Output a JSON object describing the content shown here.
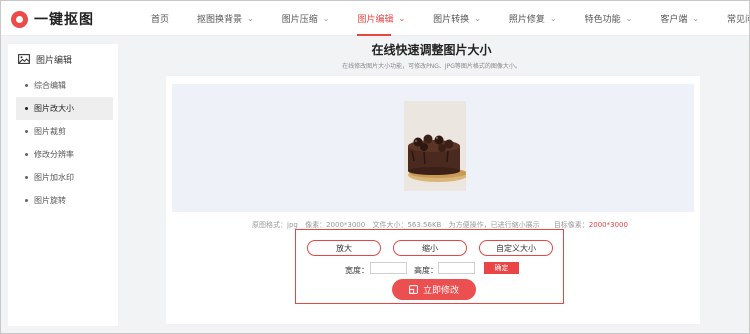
{
  "app": {
    "logo_text": "一键抠图"
  },
  "nav": {
    "items": [
      {
        "label": "首页",
        "has_menu": false
      },
      {
        "label": "抠图换背景",
        "has_menu": true
      },
      {
        "label": "图片压缩",
        "has_menu": true
      },
      {
        "label": "图片编辑",
        "has_menu": true,
        "active": true
      },
      {
        "label": "图片转换",
        "has_menu": true
      },
      {
        "label": "照片修复",
        "has_menu": true
      },
      {
        "label": "特色功能",
        "has_menu": true
      },
      {
        "label": "客户端",
        "has_menu": true
      },
      {
        "label": "常见问题",
        "has_menu": false
      }
    ]
  },
  "sidebar": {
    "title": "图片编辑",
    "items": [
      {
        "label": "综合编辑"
      },
      {
        "label": "图片改大小",
        "active": true
      },
      {
        "label": "图片裁剪"
      },
      {
        "label": "修改分辨率"
      },
      {
        "label": "图片加水印"
      },
      {
        "label": "图片旋转"
      }
    ]
  },
  "main": {
    "title": "在线快速调整图片大小",
    "subtitle": "在线修改图片大小功能，可修改PNG、JPG等图片格式的图像大小。",
    "info": {
      "format_label": "原图格式：",
      "format_value": "jpg",
      "pixels_label": "像素：",
      "pixels_value": "2000*3000",
      "size_label": "文件大小：",
      "size_value": "563.56KB",
      "note": "为方便操作，已进行缩小展示",
      "target_label": "目标像素：",
      "target_value": "2000*3000"
    },
    "edit": {
      "enlarge": "放大",
      "shrink": "缩小",
      "custom": "自定义大小",
      "width_label": "宽度：",
      "height_label": "高度：",
      "confirm": "确定",
      "apply": "立即修改"
    }
  },
  "colors": {
    "accent": "#e94545",
    "preview_bg": "#eef1f7",
    "page_bg": "#f2f3f5"
  }
}
